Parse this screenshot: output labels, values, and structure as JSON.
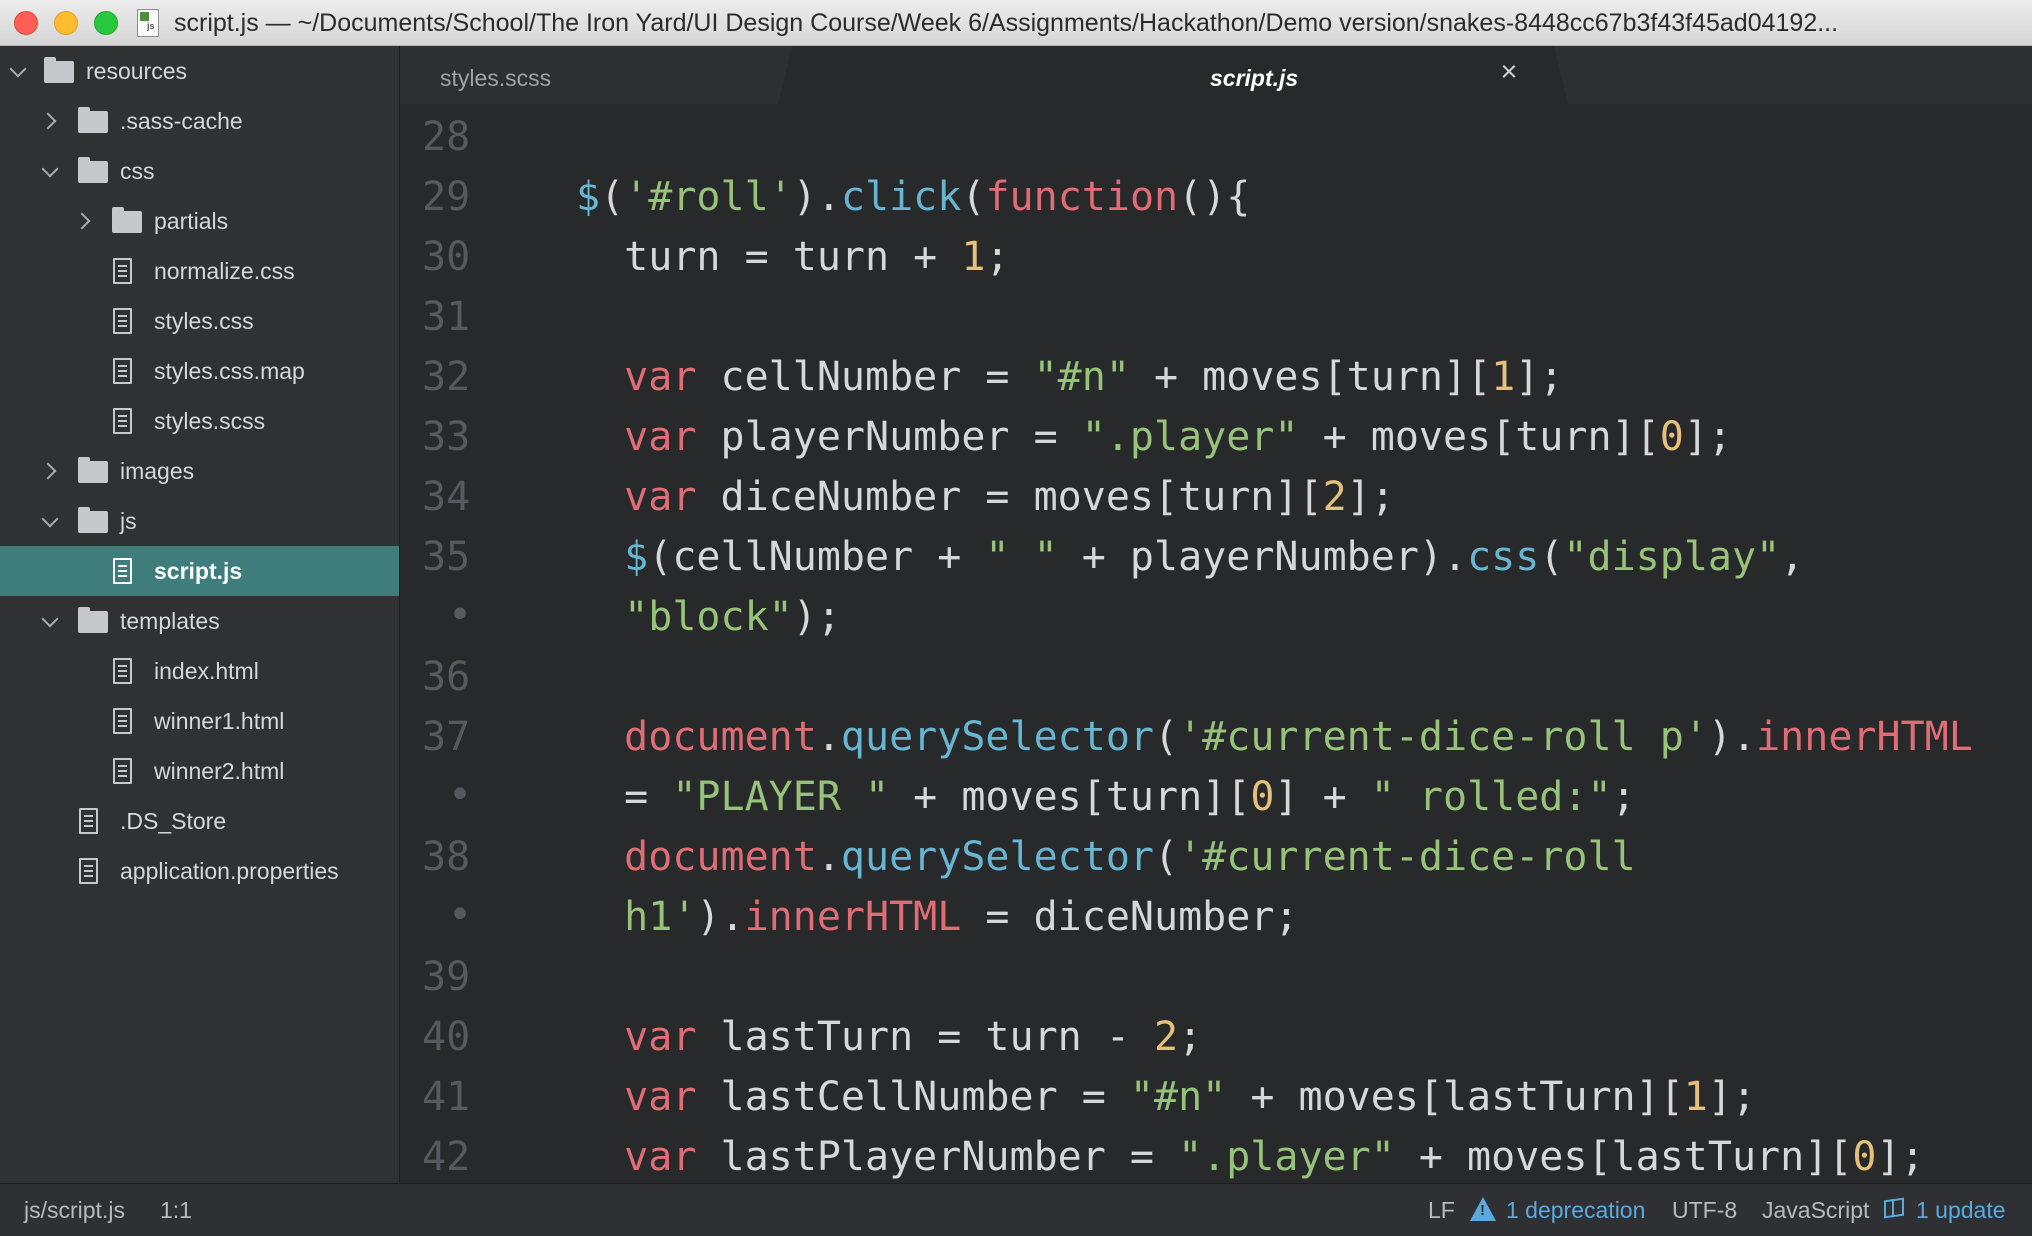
{
  "window": {
    "title": "script.js — ~/Documents/School/The Iron Yard/UI Design Course/Week 6/Assignments/Hackathon/Demo version/snakes-8448cc67b3f43f45ad04192..."
  },
  "tree": [
    {
      "label": "resources",
      "type": "folder",
      "expanded": true
    },
    {
      "label": ".sass-cache",
      "type": "folder",
      "expanded": false
    },
    {
      "label": "css",
      "type": "folder",
      "expanded": true
    },
    {
      "label": "partials",
      "type": "folder",
      "expanded": false
    },
    {
      "label": "normalize.css",
      "type": "file"
    },
    {
      "label": "styles.css",
      "type": "file"
    },
    {
      "label": "styles.css.map",
      "type": "file"
    },
    {
      "label": "styles.scss",
      "type": "file"
    },
    {
      "label": "images",
      "type": "folder",
      "expanded": false
    },
    {
      "label": "js",
      "type": "folder",
      "expanded": true
    },
    {
      "label": "script.js",
      "type": "file",
      "selected": true
    },
    {
      "label": "templates",
      "type": "folder",
      "expanded": true
    },
    {
      "label": "index.html",
      "type": "file"
    },
    {
      "label": "winner1.html",
      "type": "file"
    },
    {
      "label": "winner2.html",
      "type": "file"
    },
    {
      "label": ".DS_Store",
      "type": "file"
    },
    {
      "label": "application.properties",
      "type": "file"
    }
  ],
  "tabs": [
    {
      "label": "styles.scss",
      "active": false
    },
    {
      "label": "script.js",
      "active": true,
      "close_glyph": "×"
    }
  ],
  "editor": {
    "lines": [
      {
        "gutter": "28",
        "tokens": []
      },
      {
        "gutter": "29",
        "tokens": [
          [
            "dol",
            "$"
          ],
          [
            "plain",
            "("
          ],
          [
            "str",
            "'#roll'"
          ],
          [
            "plain",
            ")."
          ],
          [
            "fn",
            "click"
          ],
          [
            "plain",
            "("
          ],
          [
            "kw",
            "function"
          ],
          [
            "plain",
            "(){"
          ]
        ]
      },
      {
        "gutter": "30",
        "tokens": [
          [
            "plain",
            "  turn = turn + "
          ],
          [
            "num",
            "1"
          ],
          [
            "plain",
            ";"
          ]
        ]
      },
      {
        "gutter": "31",
        "tokens": []
      },
      {
        "gutter": "32",
        "tokens": [
          [
            "plain",
            "  "
          ],
          [
            "kw",
            "var"
          ],
          [
            "plain",
            " cellNumber = "
          ],
          [
            "str",
            "\"#n\""
          ],
          [
            "plain",
            " + moves[turn]["
          ],
          [
            "num",
            "1"
          ],
          [
            "plain",
            "];"
          ]
        ]
      },
      {
        "gutter": "33",
        "tokens": [
          [
            "plain",
            "  "
          ],
          [
            "kw",
            "var"
          ],
          [
            "plain",
            " playerNumber = "
          ],
          [
            "str",
            "\".player\""
          ],
          [
            "plain",
            " + moves[turn]["
          ],
          [
            "num",
            "0"
          ],
          [
            "plain",
            "];"
          ]
        ]
      },
      {
        "gutter": "34",
        "tokens": [
          [
            "plain",
            "  "
          ],
          [
            "kw",
            "var"
          ],
          [
            "plain",
            " diceNumber = moves[turn]["
          ],
          [
            "num",
            "2"
          ],
          [
            "plain",
            "];"
          ]
        ]
      },
      {
        "gutter": "35",
        "tokens": [
          [
            "plain",
            "  "
          ],
          [
            "dol",
            "$"
          ],
          [
            "plain",
            "(cellNumber + "
          ],
          [
            "str",
            "\" \""
          ],
          [
            "plain",
            " + playerNumber)."
          ],
          [
            "fn",
            "css"
          ],
          [
            "plain",
            "("
          ],
          [
            "str",
            "\"display\""
          ],
          [
            "plain",
            ","
          ]
        ]
      },
      {
        "gutter": "•",
        "tokens": [
          [
            "plain",
            "  "
          ],
          [
            "str",
            "\"block\""
          ],
          [
            "plain",
            ");"
          ]
        ]
      },
      {
        "gutter": "36",
        "tokens": []
      },
      {
        "gutter": "37",
        "tokens": [
          [
            "plain",
            "  "
          ],
          [
            "prop",
            "document"
          ],
          [
            "plain",
            "."
          ],
          [
            "fn",
            "querySelector"
          ],
          [
            "plain",
            "("
          ],
          [
            "str",
            "'#current-dice-roll p'"
          ],
          [
            "plain",
            ")."
          ],
          [
            "prop",
            "innerHTML"
          ]
        ]
      },
      {
        "gutter": "•",
        "tokens": [
          [
            "plain",
            "  = "
          ],
          [
            "str",
            "\"PLAYER \""
          ],
          [
            "plain",
            " + moves[turn]["
          ],
          [
            "num",
            "0"
          ],
          [
            "plain",
            "] + "
          ],
          [
            "str",
            "\" rolled:\""
          ],
          [
            "plain",
            ";"
          ]
        ]
      },
      {
        "gutter": "38",
        "tokens": [
          [
            "plain",
            "  "
          ],
          [
            "prop",
            "document"
          ],
          [
            "plain",
            "."
          ],
          [
            "fn",
            "querySelector"
          ],
          [
            "plain",
            "("
          ],
          [
            "str",
            "'#current-dice-roll"
          ]
        ]
      },
      {
        "gutter": "•",
        "tokens": [
          [
            "plain",
            "  "
          ],
          [
            "str",
            "h1'"
          ],
          [
            "plain",
            ")."
          ],
          [
            "prop",
            "innerHTML"
          ],
          [
            "plain",
            " = diceNumber;"
          ]
        ]
      },
      {
        "gutter": "39",
        "tokens": []
      },
      {
        "gutter": "40",
        "tokens": [
          [
            "plain",
            "  "
          ],
          [
            "kw",
            "var"
          ],
          [
            "plain",
            " lastTurn = turn - "
          ],
          [
            "num",
            "2"
          ],
          [
            "plain",
            ";"
          ]
        ]
      },
      {
        "gutter": "41",
        "tokens": [
          [
            "plain",
            "  "
          ],
          [
            "kw",
            "var"
          ],
          [
            "plain",
            " lastCellNumber = "
          ],
          [
            "str",
            "\"#n\""
          ],
          [
            "plain",
            " + moves[lastTurn]["
          ],
          [
            "num",
            "1"
          ],
          [
            "plain",
            "];"
          ]
        ]
      },
      {
        "gutter": "42",
        "tokens": [
          [
            "plain",
            "  "
          ],
          [
            "kw",
            "var"
          ],
          [
            "plain",
            " lastPlayerNumber = "
          ],
          [
            "str",
            "\".player\""
          ],
          [
            "plain",
            " + moves[lastTurn]["
          ],
          [
            "num",
            "0"
          ],
          [
            "plain",
            "];"
          ]
        ]
      }
    ]
  },
  "status": {
    "path": "js/script.js",
    "cursor": "1:1",
    "line_ending": "LF",
    "deprecation": "1 deprecation",
    "encoding": "UTF-8",
    "grammar": "JavaScript",
    "update": "1 update"
  },
  "colors": {
    "keyword": "#e06c75",
    "function": "#67b5d1",
    "string": "#97c279",
    "number": "#e5c07b",
    "selection": "#3f7d7d",
    "link": "#5aa9df"
  },
  "icons": [
    "folder-icon",
    "file-icon",
    "chevron-down-icon",
    "chevron-right-icon",
    "close-icon",
    "warning-icon",
    "package-icon"
  ]
}
